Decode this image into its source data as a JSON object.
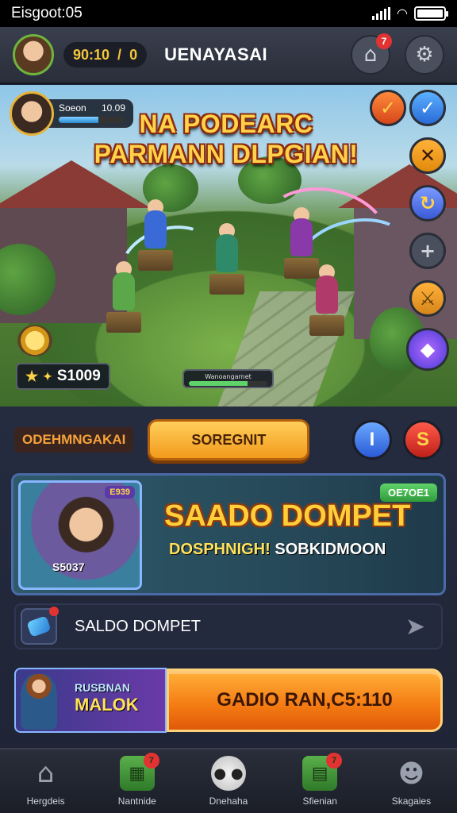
{
  "status_bar": {
    "time": "Eisgoot:05"
  },
  "top_bar": {
    "currency_value": "90:10",
    "currency_secondary": "0",
    "title": "UENAYASAI",
    "home_badge": "7"
  },
  "player": {
    "name": "Soeon",
    "score": "10.09",
    "health_fraction": 0.6
  },
  "scene": {
    "headline_line1": "NA PODEARC",
    "headline_line2": "PARMANN DLPGIAN!",
    "score_value": "S1009",
    "progress_label": "Wanoangarnet",
    "progress_fraction": 0.75
  },
  "actions": {
    "deal_label": "ODEHMNGAKAI",
    "primary_button": "SOREGNIT",
    "info_button": "I",
    "currency_button": "S"
  },
  "banner": {
    "badge": "E939",
    "art_value": "S5037",
    "corner_badge": "OE7OE1",
    "title": "SAADO DOMPET",
    "subtitle_left": "DOSPHNIGH!",
    "subtitle_right": "SOBKIDMOON"
  },
  "wallet": {
    "label": "SALDO DOMPET"
  },
  "promo": {
    "tile_line1": "RUSBNAN",
    "tile_line2": "MALOK",
    "button": "GADIO RAN,C5:110"
  },
  "nav": [
    {
      "label": "Hergdeis",
      "badge": ""
    },
    {
      "label": "Nantnide",
      "badge": "7"
    },
    {
      "label": "Dnehaha",
      "badge": ""
    },
    {
      "label": "Sfienian",
      "badge": "7"
    },
    {
      "label": "Skagaies",
      "badge": ""
    }
  ],
  "colors": {
    "accent_orange": "#f29a1c",
    "accent_gold": "#ffd24a",
    "badge_red": "#e33232",
    "panel_bg": "#1f2536"
  },
  "icons": [
    "home-icon",
    "map-icon",
    "face-icon",
    "quest-icon",
    "profile-icon",
    "settings-icon",
    "check-icon",
    "close-icon",
    "plus-icon",
    "gem-icon"
  ]
}
